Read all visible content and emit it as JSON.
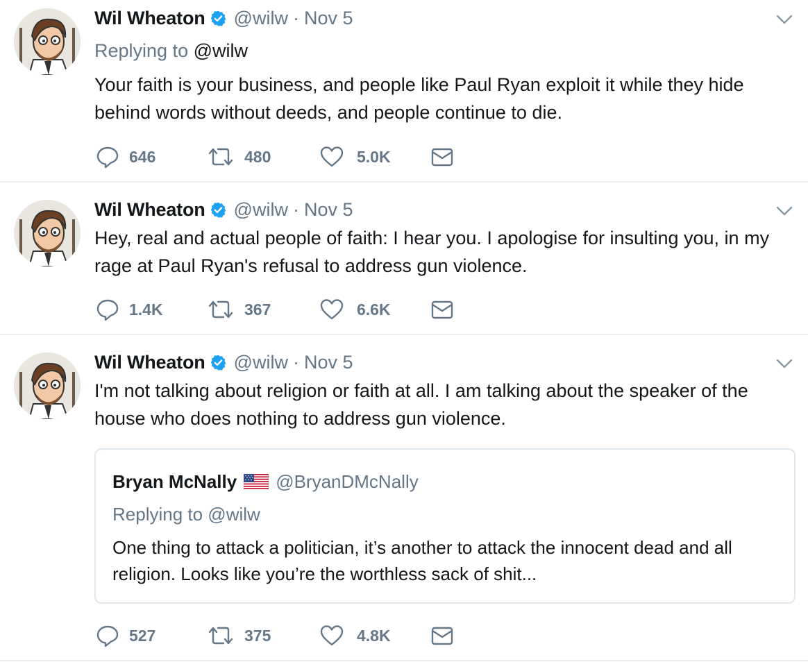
{
  "tweets": [
    {
      "author_name": "Wil Wheaton",
      "author_handle": "@wilw",
      "separator": "·",
      "date": "Nov 5",
      "replying_label": "Replying to",
      "replying_handle": "@wilw",
      "text": "Your faith is your business, and people like Paul Ryan exploit it while they hide behind words without deeds, and people continue to die.",
      "replies": "646",
      "retweets": "480",
      "likes": "5.0K"
    },
    {
      "author_name": "Wil Wheaton",
      "author_handle": "@wilw",
      "separator": "·",
      "date": "Nov 5",
      "text": "Hey, real and actual people of faith: I hear you. I apologise for insulting you, in my rage at Paul Ryan's refusal to address gun violence.",
      "replies": "1.4K",
      "retweets": "367",
      "likes": "6.6K"
    },
    {
      "author_name": "Wil Wheaton",
      "author_handle": "@wilw",
      "separator": "·",
      "date": "Nov 5",
      "text": "I'm not talking about religion or faith at all. I am talking about the speaker of the house who does nothing to address gun violence.",
      "quote": {
        "author_name": "Bryan McNally",
        "author_handle": "@BryanDMcNally",
        "replying_text": "Replying to @wilw",
        "text": "One thing to attack a politician, it’s another to attack the innocent dead and all religion. Looks like you’re the worthless sack of shit..."
      },
      "replies": "527",
      "retweets": "375",
      "likes": "4.8K"
    }
  ],
  "icons": {
    "verified": "verified-badge-icon",
    "chevron": "chevron-down-icon",
    "reply": "reply-icon",
    "retweet": "retweet-icon",
    "like": "heart-icon",
    "dm": "envelope-icon",
    "flag": "us-flag-icon"
  },
  "colors": {
    "text": "#14171a",
    "secondary": "#657786",
    "verified_blue": "#1da1f2",
    "divider": "#e6ecf0",
    "quote_border": "#e1e8ed"
  }
}
